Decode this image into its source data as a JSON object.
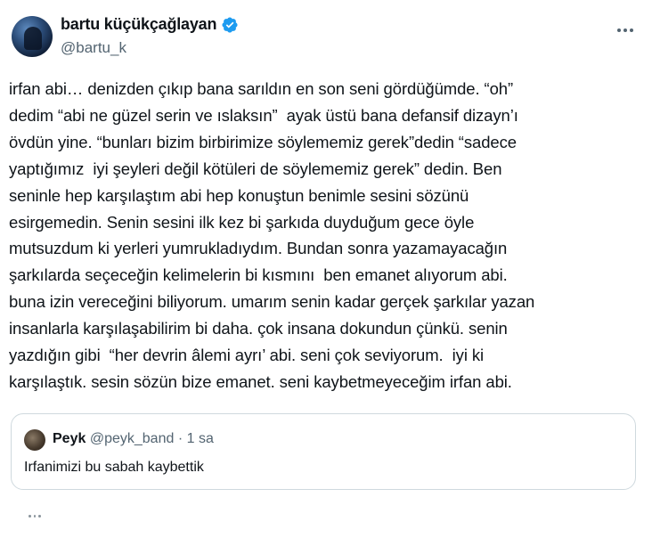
{
  "author": {
    "display_name": "bartu küçükçağlayan",
    "handle": "@bartu_k",
    "verified": true,
    "avatar_icon": "avatar-photo"
  },
  "tweet": {
    "text": "irfan abi… denizden çıkıp bana sarıldın en son seni gördüğümde. “oh”\ndedim “abi ne güzel serin ve ıslaksın”  ayak üstü bana defansif dizayn’ı\növdün yine. “bunları bizim birbirimize söylememiz gerek”dedin “sadece\nyaptığımız  iyi şeyleri değil kötüleri de söylememiz gerek” dedin. Ben\nseninle hep karşılaştım abi hep konuştun benimle sesini sözünü\nesirgemedin. Senin sesini ilk kez bi şarkıda duyduğum gece öyle\nmutsuzdum ki yerleri yumrukladıydım. Bundan sonra yazamayacağın\nşarkılarda seçeceğin kelimelerin bi kısmını  ben emanet alıyorum abi.\nbuna izin vereceğini biliyorum. umarım senin kadar gerçek şarkılar yazan\ninsanlarla karşılaşabilirim bi daha. çok insana dokundun çünkü. senin\nyazdığın gibi  “her devrin âlemi ayrı’ abi. seni çok seviyorum.  iyi ki\nkarşılaştık. sesin sözün bize emanet. seni kaybetmeyeceğim irfan abi."
  },
  "quoted_tweet": {
    "name": "Peyk",
    "handle": "@peyk_band",
    "separator": "·",
    "time": "1 sa",
    "text": "Irfanimizi bu sabah kaybettik"
  },
  "icons": {
    "verified": "verified-badge-icon",
    "more": "more-options-icon"
  },
  "colors": {
    "verified_blue": "#1d9bf0",
    "text_primary": "#0f1419",
    "text_secondary": "#536471",
    "border": "#cfd9de"
  }
}
